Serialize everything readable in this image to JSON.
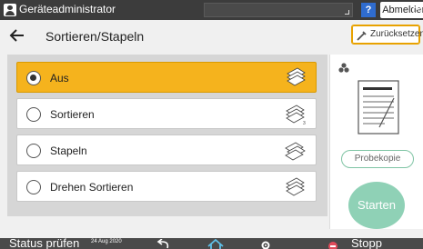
{
  "header": {
    "user_name": "Geräteadministrator",
    "help_label": "?",
    "logout_label": "Abmelden"
  },
  "title_row": {
    "title": "Sortieren/Stapeln",
    "reset_label": "Zurücksetzen"
  },
  "options": [
    {
      "label": "Aus",
      "selected": true
    },
    {
      "label": "Sortieren",
      "selected": false
    },
    {
      "label": "Stapeln",
      "selected": false
    },
    {
      "label": "Drehen Sortieren",
      "selected": false
    }
  ],
  "preview": {
    "probekopie_label": "Probekopie",
    "start_label": "Starten"
  },
  "bottom": {
    "status_check_label": "Status prüfen",
    "date": "24 Aug 2020",
    "stop_label": "Stopp"
  },
  "icons": {
    "user": "user-icon",
    "power": "power-icon",
    "back": "back-arrow-icon",
    "reset": "reset-icon",
    "color": "color-icon",
    "document": "document-preview-icon",
    "nav_back": "undo-icon",
    "home": "home-icon",
    "settings": "gear-icon",
    "stop": "stop-icon"
  },
  "colors": {
    "selected": "#f5b31d",
    "topbar": "#3c3c3c",
    "accent_green": "#8fd1b6",
    "help_blue": "#2f6ccf",
    "stop_red": "#e14b5a"
  }
}
